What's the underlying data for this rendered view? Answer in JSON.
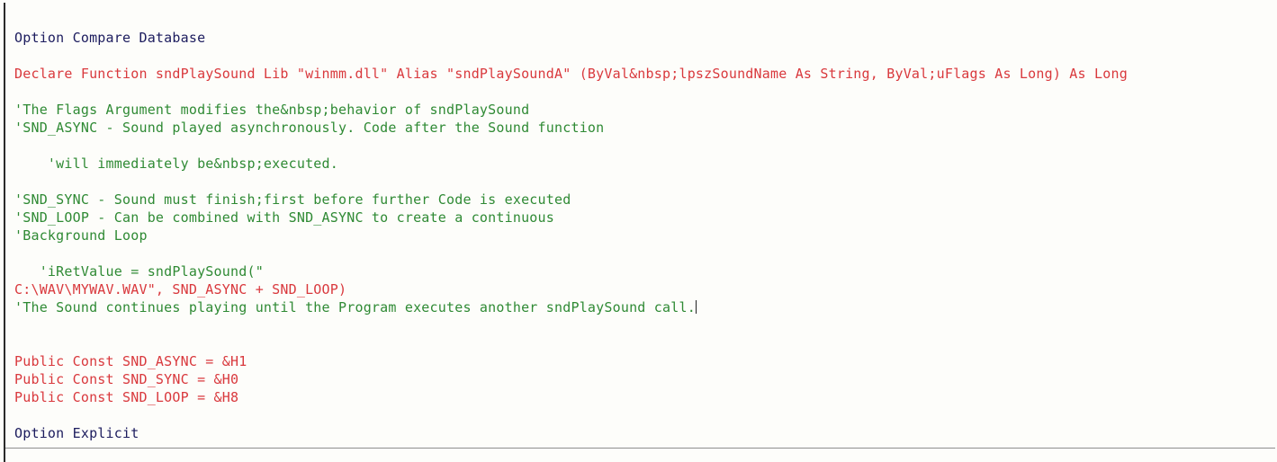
{
  "document": {
    "kind": "vba-code-listing",
    "background_color": "#fdfdfa",
    "colors": {
      "keyword": "#1c1c5e",
      "code": "#d9393d",
      "comment": "#2f8a34",
      "left_rule": "#2a2a2a",
      "divider": "#8e8e8e",
      "caret": "#222222"
    },
    "caret_line_index": 15,
    "lines": [
      {
        "text": "Option Compare Database",
        "style": "keyword"
      },
      {
        "text": "",
        "style": "blank"
      },
      {
        "text": "Declare Function sndPlaySound Lib \"winmm.dll\" Alias \"sndPlaySoundA\" (ByVal&nbsp;lpszSoundName As String, ByVal;uFlags As Long) As Long",
        "style": "code"
      },
      {
        "text": "",
        "style": "blank"
      },
      {
        "text": "'The Flags Argument modifies the&nbsp;behavior of sndPlaySound",
        "style": "comment"
      },
      {
        "text": "'SND_ASYNC - Sound played asynchronously. Code after the Sound function",
        "style": "comment"
      },
      {
        "text": "",
        "style": "blank"
      },
      {
        "text": "    'will immediately be&nbsp;executed.",
        "style": "comment"
      },
      {
        "text": "",
        "style": "blank"
      },
      {
        "text": "'SND_SYNC - Sound must finish;first before further Code is executed",
        "style": "comment"
      },
      {
        "text": "'SND_LOOP - Can be combined with SND_ASYNC to create a continuous",
        "style": "comment"
      },
      {
        "text": "'Background Loop",
        "style": "comment"
      },
      {
        "text": "",
        "style": "blank"
      },
      {
        "text": "   'iRetValue = sndPlaySound(\"",
        "style": "comment"
      },
      {
        "text": "C:\\WAV\\MYWAV.WAV\", SND_ASYNC + SND_LOOP)",
        "style": "code"
      },
      {
        "text": "'The Sound continues playing until the Program executes another sndPlaySound call.",
        "style": "comment"
      },
      {
        "text": "",
        "style": "blank"
      },
      {
        "text": "",
        "style": "blank"
      },
      {
        "text": "Public Const SND_ASYNC = &H1",
        "style": "code"
      },
      {
        "text": "Public Const SND_SYNC = &H0",
        "style": "code"
      },
      {
        "text": "Public Const SND_LOOP = &H8",
        "style": "code"
      },
      {
        "text": "",
        "style": "blank"
      },
      {
        "text": "Option Explicit",
        "style": "keyword"
      }
    ]
  }
}
